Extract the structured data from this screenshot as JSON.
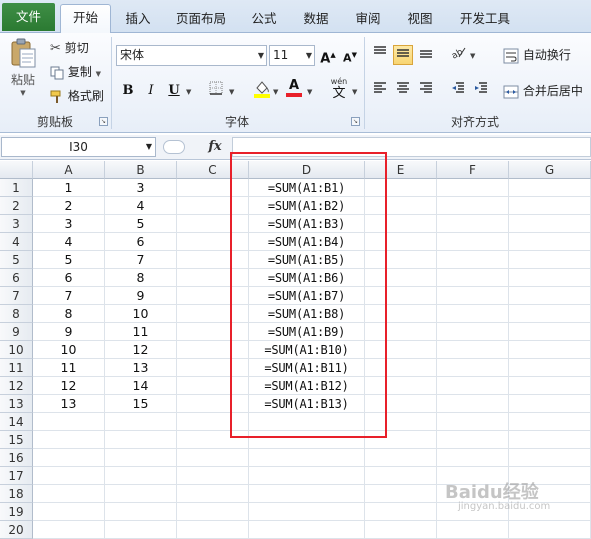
{
  "tabs": {
    "file": "文件",
    "items": [
      "开始",
      "插入",
      "页面布局",
      "公式",
      "数据",
      "审阅",
      "视图",
      "开发工具"
    ],
    "active_index": 0
  },
  "clipboard": {
    "paste_label": "粘贴",
    "cut_label": "剪切",
    "copy_label": "复制",
    "format_painter_label": "格式刷",
    "group_label": "剪贴板"
  },
  "font": {
    "font_name": "宋体",
    "font_size": "11",
    "bold": "B",
    "italic": "I",
    "underline": "U",
    "grow": "A",
    "shrink": "A",
    "font_color_letter": "A",
    "phonetic_top": "wén",
    "phonetic_char": "文",
    "group_label": "字体"
  },
  "alignment": {
    "wrap_text_label": "自动换行",
    "merge_center_label": "合并后居中",
    "group_label": "对齐方式"
  },
  "formula_bar": {
    "name_box": "I30",
    "fx": "fx",
    "content": ""
  },
  "grid": {
    "columns": [
      "A",
      "B",
      "C",
      "D",
      "E",
      "F",
      "G"
    ],
    "rows": [
      "1",
      "2",
      "3",
      "4",
      "5",
      "6",
      "7",
      "8",
      "9",
      "10",
      "11",
      "12",
      "13",
      "14",
      "15",
      "16",
      "17",
      "18",
      "19",
      "20"
    ],
    "col_a": [
      "1",
      "2",
      "3",
      "4",
      "5",
      "6",
      "7",
      "8",
      "9",
      "10",
      "11",
      "12",
      "13"
    ],
    "col_b": [
      "3",
      "4",
      "5",
      "6",
      "7",
      "8",
      "9",
      "10",
      "11",
      "12",
      "13",
      "14",
      "15"
    ],
    "col_d": [
      "=SUM(A1:B1)",
      "=SUM(A1:B2)",
      "=SUM(A1:B3)",
      "=SUM(A1:B4)",
      "=SUM(A1:B5)",
      "=SUM(A1:B6)",
      "=SUM(A1:B7)",
      "=SUM(A1:B8)",
      "=SUM(A1:B9)",
      "=SUM(A1:B10)",
      "=SUM(A1:B11)",
      "=SUM(A1:B12)",
      "=SUM(A1:B13)"
    ]
  },
  "colors": {
    "file_tab": "#2b7a32",
    "highlight_box": "#e8202a",
    "active_button": "#f8d572"
  },
  "watermark": "Baidu经验",
  "watermark_sub": "jingyan.baidu.com"
}
